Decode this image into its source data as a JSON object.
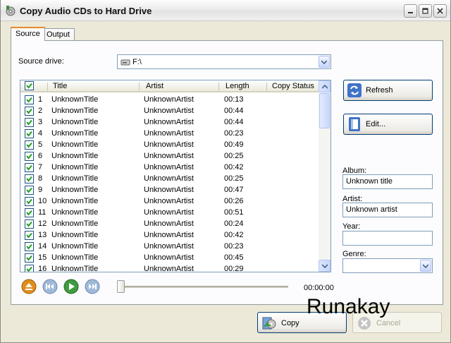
{
  "window": {
    "title": "Copy Audio CDs to Hard Drive"
  },
  "tabs": [
    {
      "label": "Source",
      "active": true
    },
    {
      "label": "Output",
      "active": false
    }
  ],
  "source": {
    "label": "Source drive:",
    "value": "F:\\"
  },
  "tracklist": {
    "columns": [
      "Title",
      "Artist",
      "Length",
      "Copy Status"
    ],
    "rows": [
      {
        "num": "1",
        "title": "UnknownTitle",
        "artist": "UnknownArtist",
        "length": "00:13",
        "status": "",
        "checked": true
      },
      {
        "num": "2",
        "title": "UnknownTitle",
        "artist": "UnknownArtist",
        "length": "00:44",
        "status": "",
        "checked": true
      },
      {
        "num": "3",
        "title": "UnknownTitle",
        "artist": "UnknownArtist",
        "length": "00:44",
        "status": "",
        "checked": true
      },
      {
        "num": "4",
        "title": "UnknownTitle",
        "artist": "UnknownArtist",
        "length": "00:23",
        "status": "",
        "checked": true
      },
      {
        "num": "5",
        "title": "UnknownTitle",
        "artist": "UnknownArtist",
        "length": "00:49",
        "status": "",
        "checked": true
      },
      {
        "num": "6",
        "title": "UnknownTitle",
        "artist": "UnknownArtist",
        "length": "00:25",
        "status": "",
        "checked": true
      },
      {
        "num": "7",
        "title": "UnknownTitle",
        "artist": "UnknownArtist",
        "length": "00:42",
        "status": "",
        "checked": true
      },
      {
        "num": "8",
        "title": "UnknownTitle",
        "artist": "UnknownArtist",
        "length": "00:25",
        "status": "",
        "checked": true
      },
      {
        "num": "9",
        "title": "UnknownTitle",
        "artist": "UnknownArtist",
        "length": "00:47",
        "status": "",
        "checked": true
      },
      {
        "num": "10",
        "title": "UnknownTitle",
        "artist": "UnknownArtist",
        "length": "00:26",
        "status": "",
        "checked": true
      },
      {
        "num": "11",
        "title": "UnknownTitle",
        "artist": "UnknownArtist",
        "length": "00:51",
        "status": "",
        "checked": true
      },
      {
        "num": "12",
        "title": "UnknownTitle",
        "artist": "UnknownArtist",
        "length": "00:24",
        "status": "",
        "checked": true
      },
      {
        "num": "13",
        "title": "UnknownTitle",
        "artist": "UnknownArtist",
        "length": "00:42",
        "status": "",
        "checked": true
      },
      {
        "num": "14",
        "title": "UnknownTitle",
        "artist": "UnknownArtist",
        "length": "00:23",
        "status": "",
        "checked": true
      },
      {
        "num": "15",
        "title": "UnknownTitle",
        "artist": "UnknownArtist",
        "length": "00:45",
        "status": "",
        "checked": true
      },
      {
        "num": "16",
        "title": "UnknownTitle",
        "artist": "UnknownArtist",
        "length": "00:29",
        "status": "",
        "checked": true
      }
    ]
  },
  "actions": {
    "refresh": "Refresh",
    "edit": "Edit..."
  },
  "metadata": {
    "album_label": "Album:",
    "album_value": "Unknown title",
    "artist_label": "Artist:",
    "artist_value": "Unknown artist",
    "year_label": "Year:",
    "year_value": "",
    "genre_label": "Genre:",
    "genre_value": ""
  },
  "player": {
    "time": "00:00:00",
    "position": 0
  },
  "footer": {
    "copy": "Copy",
    "cancel": "Cancel"
  },
  "watermark": "Runakay",
  "colors": {
    "accent_tab": "#e68b2c",
    "button_border": "#003c74",
    "field_border": "#7f9db9",
    "check": "#21a121"
  }
}
